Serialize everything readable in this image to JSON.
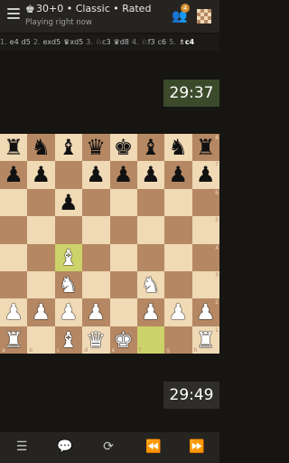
{
  "header": {
    "title_icon": "♚",
    "title": "30+0 • Classic • Rated",
    "subtitle": "Playing right now",
    "badge": "4"
  },
  "moves": [
    {
      "num": "1.",
      "white": "e4",
      "black": "d5"
    },
    {
      "num": "2.",
      "white": "exd5",
      "black": "♛xd5"
    },
    {
      "num": "3.",
      "white": "♘c3",
      "black": "♛d8"
    },
    {
      "num": "4.",
      "white": "♘f3",
      "black": "c6"
    },
    {
      "num": "5.",
      "white": "♗c4",
      "black": ""
    }
  ],
  "clocks": {
    "top": "29:37",
    "bottom": "29:49"
  },
  "board": {
    "ranks": [
      "8",
      "7",
      "6",
      "5",
      "4",
      "3",
      "2",
      "1"
    ],
    "files": [
      "a",
      "b",
      "c",
      "d",
      "e",
      "f",
      "g",
      "h"
    ],
    "position": [
      [
        "r",
        "n",
        "b",
        "q",
        "k",
        "b",
        "n",
        "r"
      ],
      [
        "p",
        "p",
        "",
        "p",
        "p",
        "p",
        "p",
        "p"
      ],
      [
        "",
        "",
        "p",
        "",
        "",
        "",
        "",
        ""
      ],
      [
        "",
        "",
        "",
        "",
        "",
        "",
        "",
        ""
      ],
      [
        "",
        "",
        "B",
        "",
        "",
        "",
        "",
        ""
      ],
      [
        "",
        "",
        "N",
        "",
        "",
        "N",
        "",
        ""
      ],
      [
        "P",
        "P",
        "P",
        "P",
        "",
        "P",
        "P",
        "P"
      ],
      [
        "R",
        "",
        "B",
        "Q",
        "K",
        "",
        "",
        "R"
      ]
    ],
    "highlights": [
      "c4",
      "f1"
    ]
  },
  "icons": {
    "menu": "menu-icon",
    "friends": "friends-icon",
    "board": "board-icon",
    "bottom": [
      "list-icon",
      "chat-icon",
      "flip-icon",
      "prev-icon",
      "next-icon"
    ]
  }
}
